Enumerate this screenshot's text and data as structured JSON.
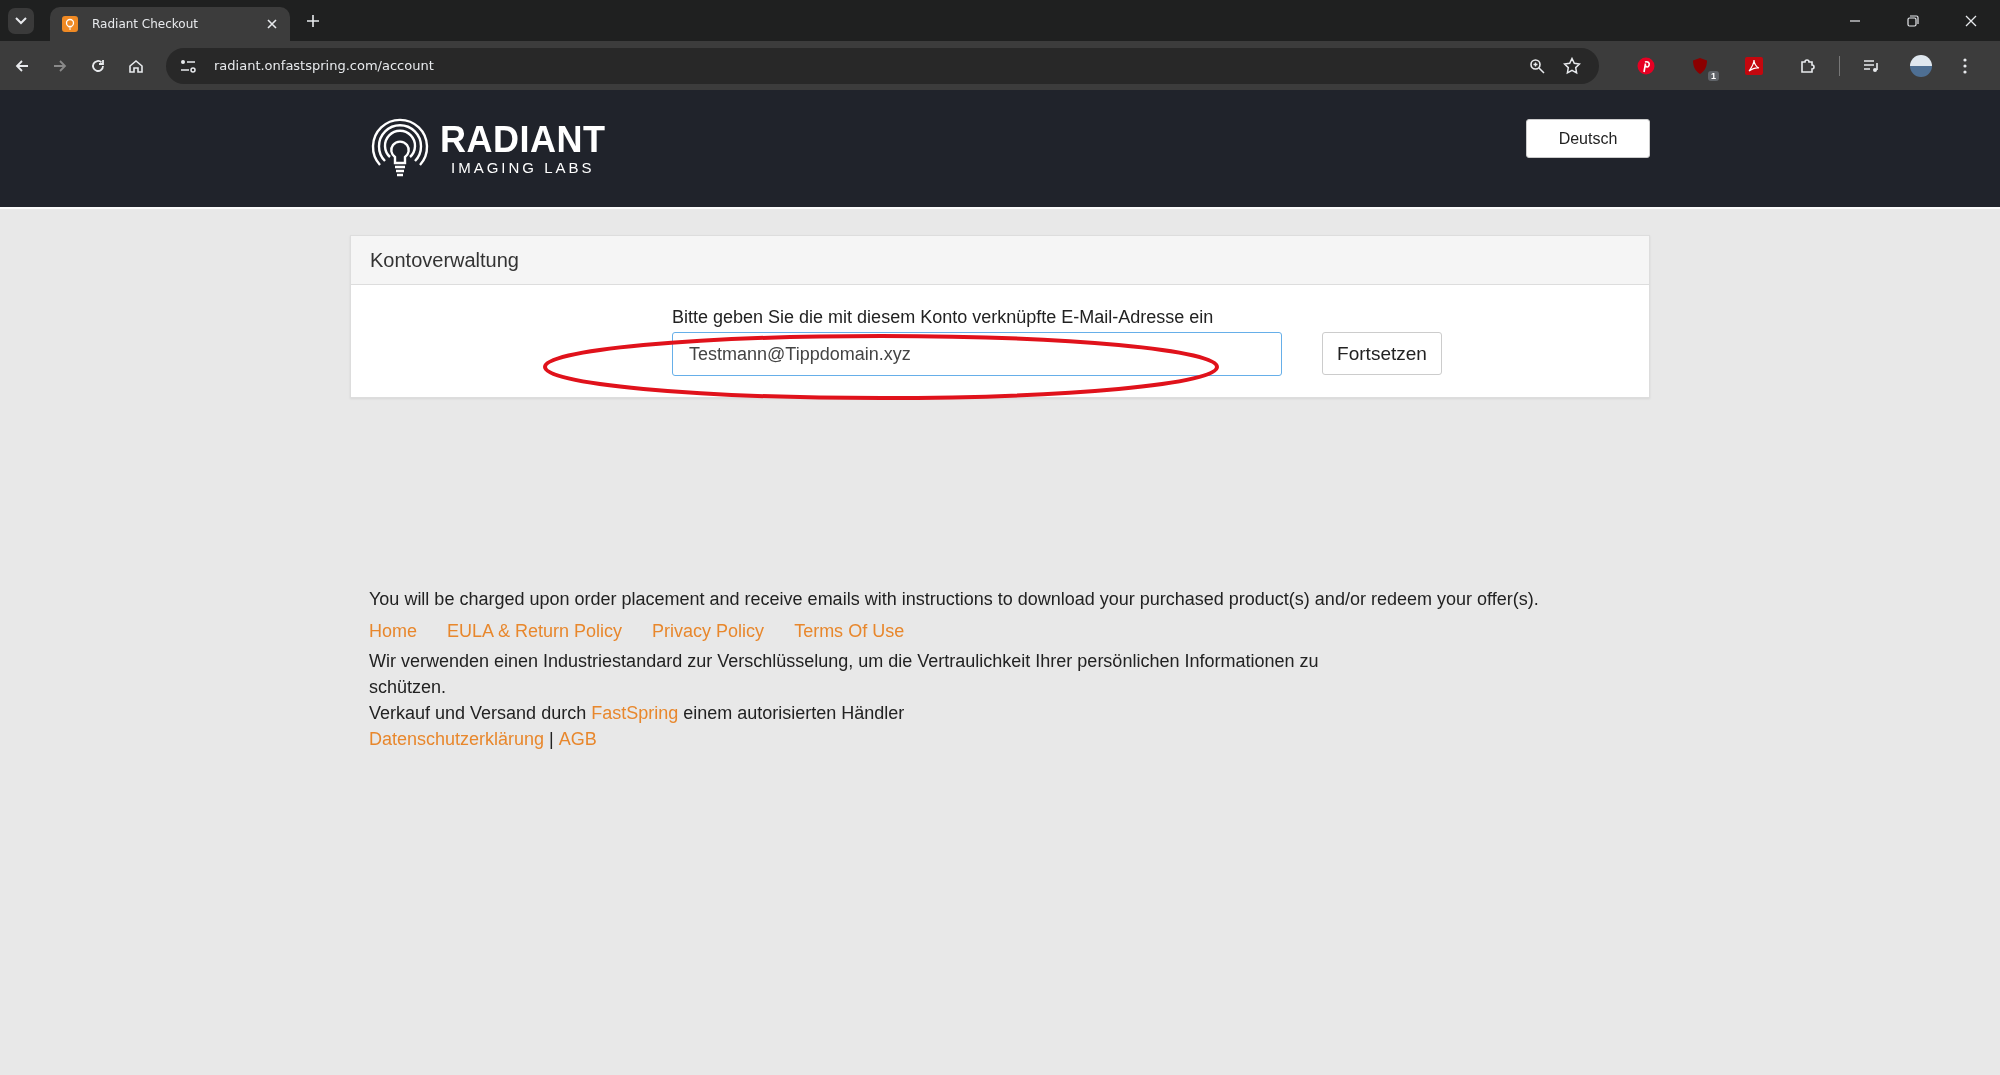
{
  "browser": {
    "tab_title": "Radiant Checkout",
    "url": "radiant.onfastspring.com/account",
    "extension_badge": "1"
  },
  "header": {
    "logo_name": "RADIANT",
    "logo_sub": "IMAGING LABS",
    "language_button": "Deutsch"
  },
  "card": {
    "title": "Kontoverwaltung",
    "label": "Bitte geben Sie die mit diesem Konto verknüpfte E-Mail-Adresse ein",
    "email_value": "Testmann@Tippdomain.xyz",
    "button": "Fortsetzen"
  },
  "footer": {
    "notice": "You will be charged upon order placement and receive emails with instructions to download your purchased product(s) and/or redeem your offer(s).",
    "links": [
      "Home",
      "EULA & Return Policy",
      "Privacy Policy",
      "Terms Of Use"
    ],
    "security_text": "Wir verwenden einen Industriestandard zur Verschlüsselung, um die Vertraulichkeit Ihrer persönlichen Informationen zu schützen.",
    "sold_by": {
      "prefix": "Verkauf und Versand durch",
      "link": "FastSpring",
      "suffix": "einem autorisierten Händler"
    },
    "legal_links": [
      "Datenschutzerklärung",
      "AGB"
    ],
    "legal_separator": "|"
  }
}
